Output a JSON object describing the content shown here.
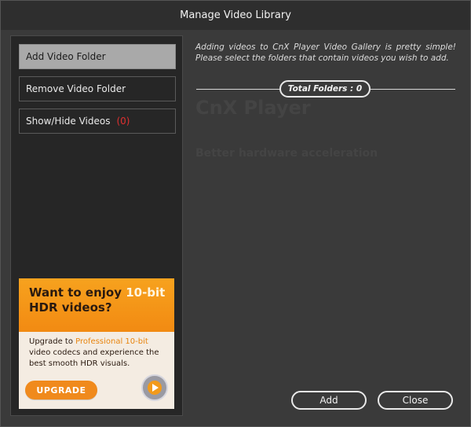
{
  "dialog": {
    "title": "Manage Video Library"
  },
  "sidebar": {
    "items": [
      {
        "label": "Add Video Folder"
      },
      {
        "label": "Remove Video Folder"
      },
      {
        "label": "Show/Hide Videos",
        "badge": "(0)"
      }
    ]
  },
  "ad": {
    "headline_part1": "Want to enjoy ",
    "headline_highlight": "10-bit",
    "headline_part2": "HDR videos?",
    "body_part1": "Upgrade to ",
    "body_highlight": "Professional 10-bit",
    "body_part2": "video codecs and experience the best smooth HDR visuals.",
    "button_label": "UPGRADE",
    "colors": {
      "orange": "#f28a12"
    }
  },
  "main": {
    "intro_text": "Adding videos to CnX Player Video Gallery is pretty simple! Please select the folders that contain videos you wish to add.",
    "total_folders_label": "Total Folders : 0"
  },
  "watermark": {
    "title": "CnX Player",
    "subtitle": "Better hardware acceleration"
  },
  "footer": {
    "add_label": "Add",
    "close_label": "Close"
  }
}
